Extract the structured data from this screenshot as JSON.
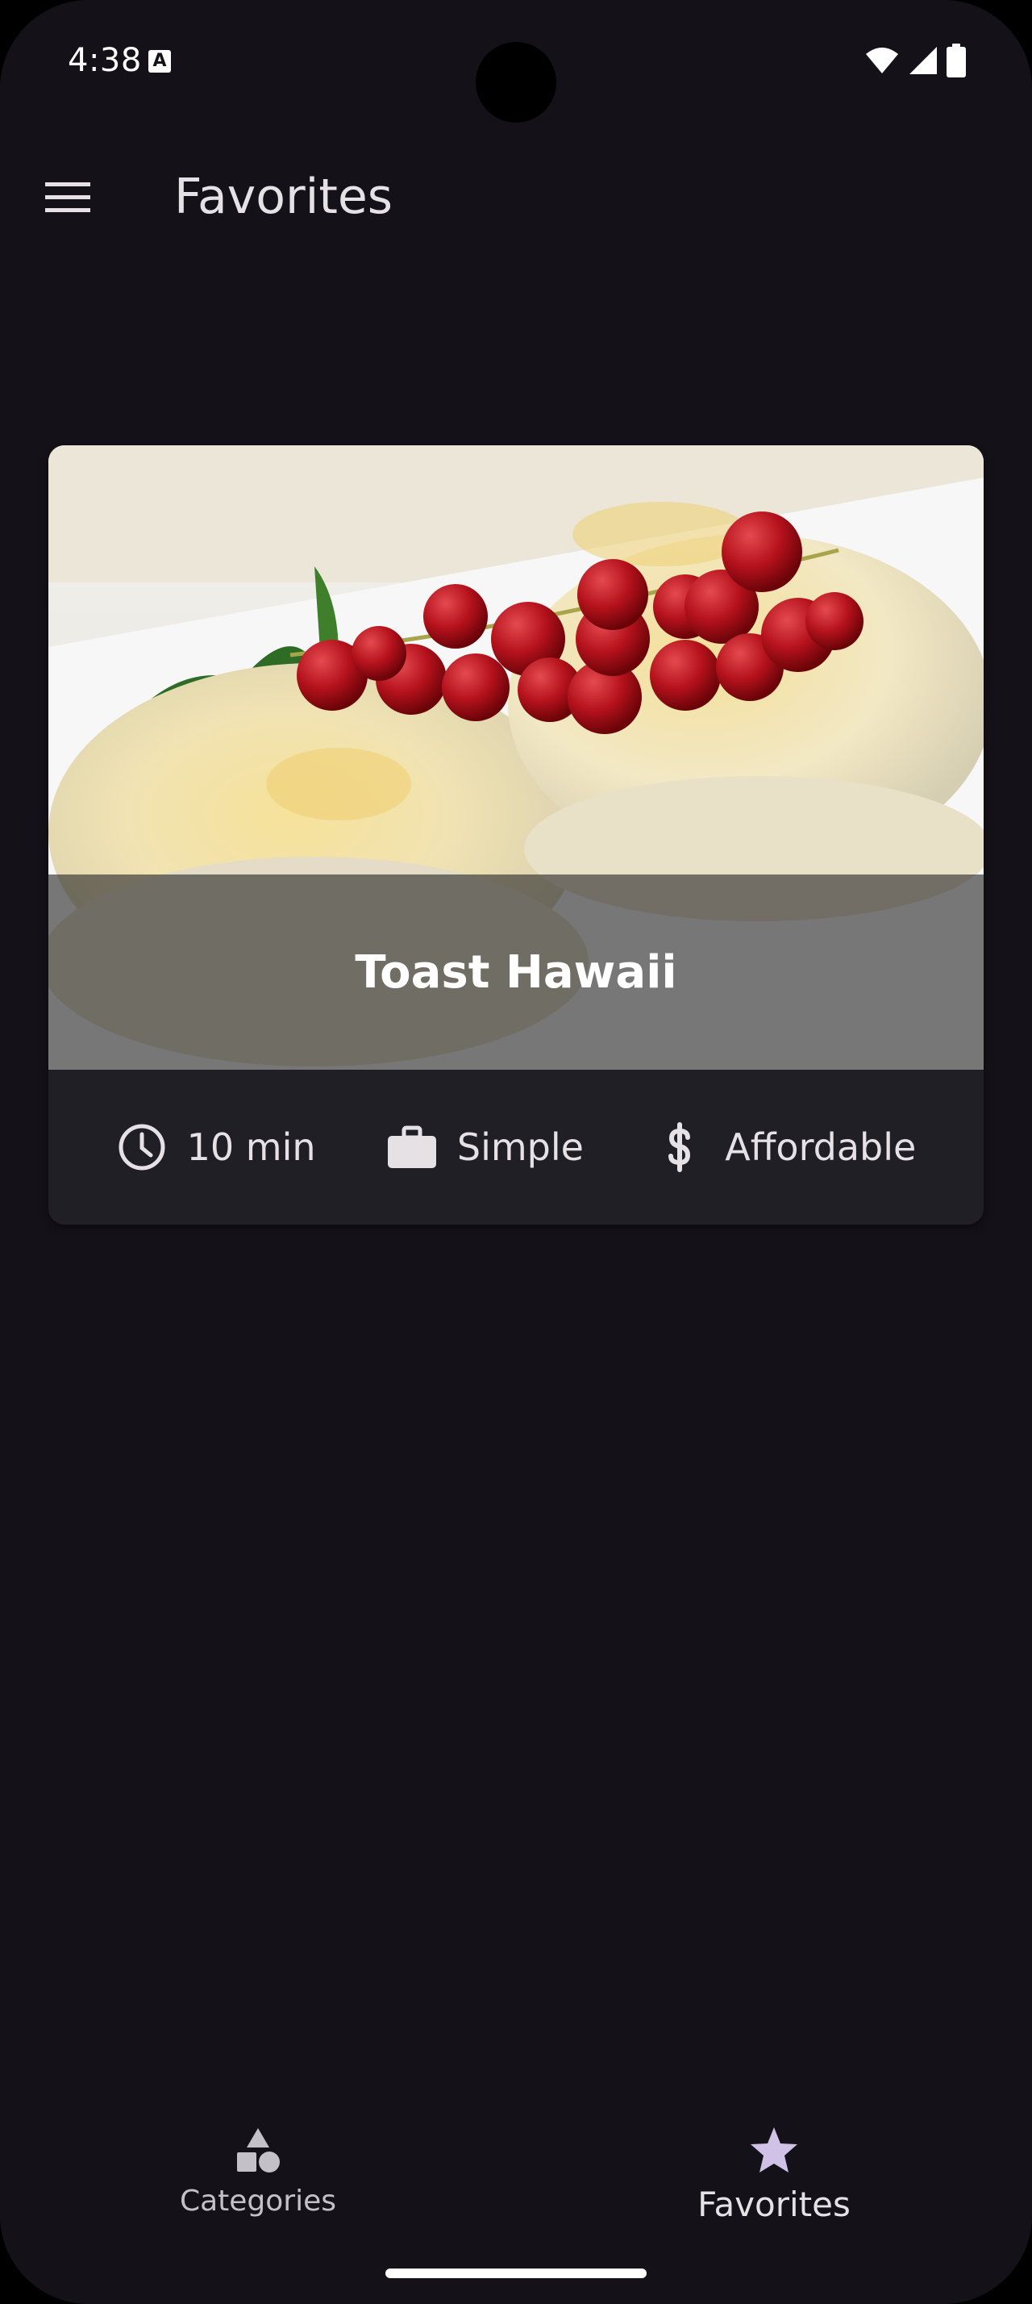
{
  "status_bar": {
    "time": "4:38",
    "notification_icon": "A"
  },
  "app_bar": {
    "menu_icon": "hamburger-menu-icon",
    "title": "Favorites"
  },
  "meal": {
    "title": "Toast Hawaii",
    "duration": "10 min",
    "complexity": "Simple",
    "affordability": "Affordable"
  },
  "bottom_nav": {
    "items": [
      {
        "label": "Categories",
        "icon": "categories-shapes-icon",
        "active": false
      },
      {
        "label": "Favorites",
        "icon": "star-icon",
        "active": true
      }
    ]
  },
  "colors": {
    "background": "#141218",
    "card": "#211f26",
    "accent_star": "#cfc2e6",
    "text": "#e6e1e5"
  }
}
